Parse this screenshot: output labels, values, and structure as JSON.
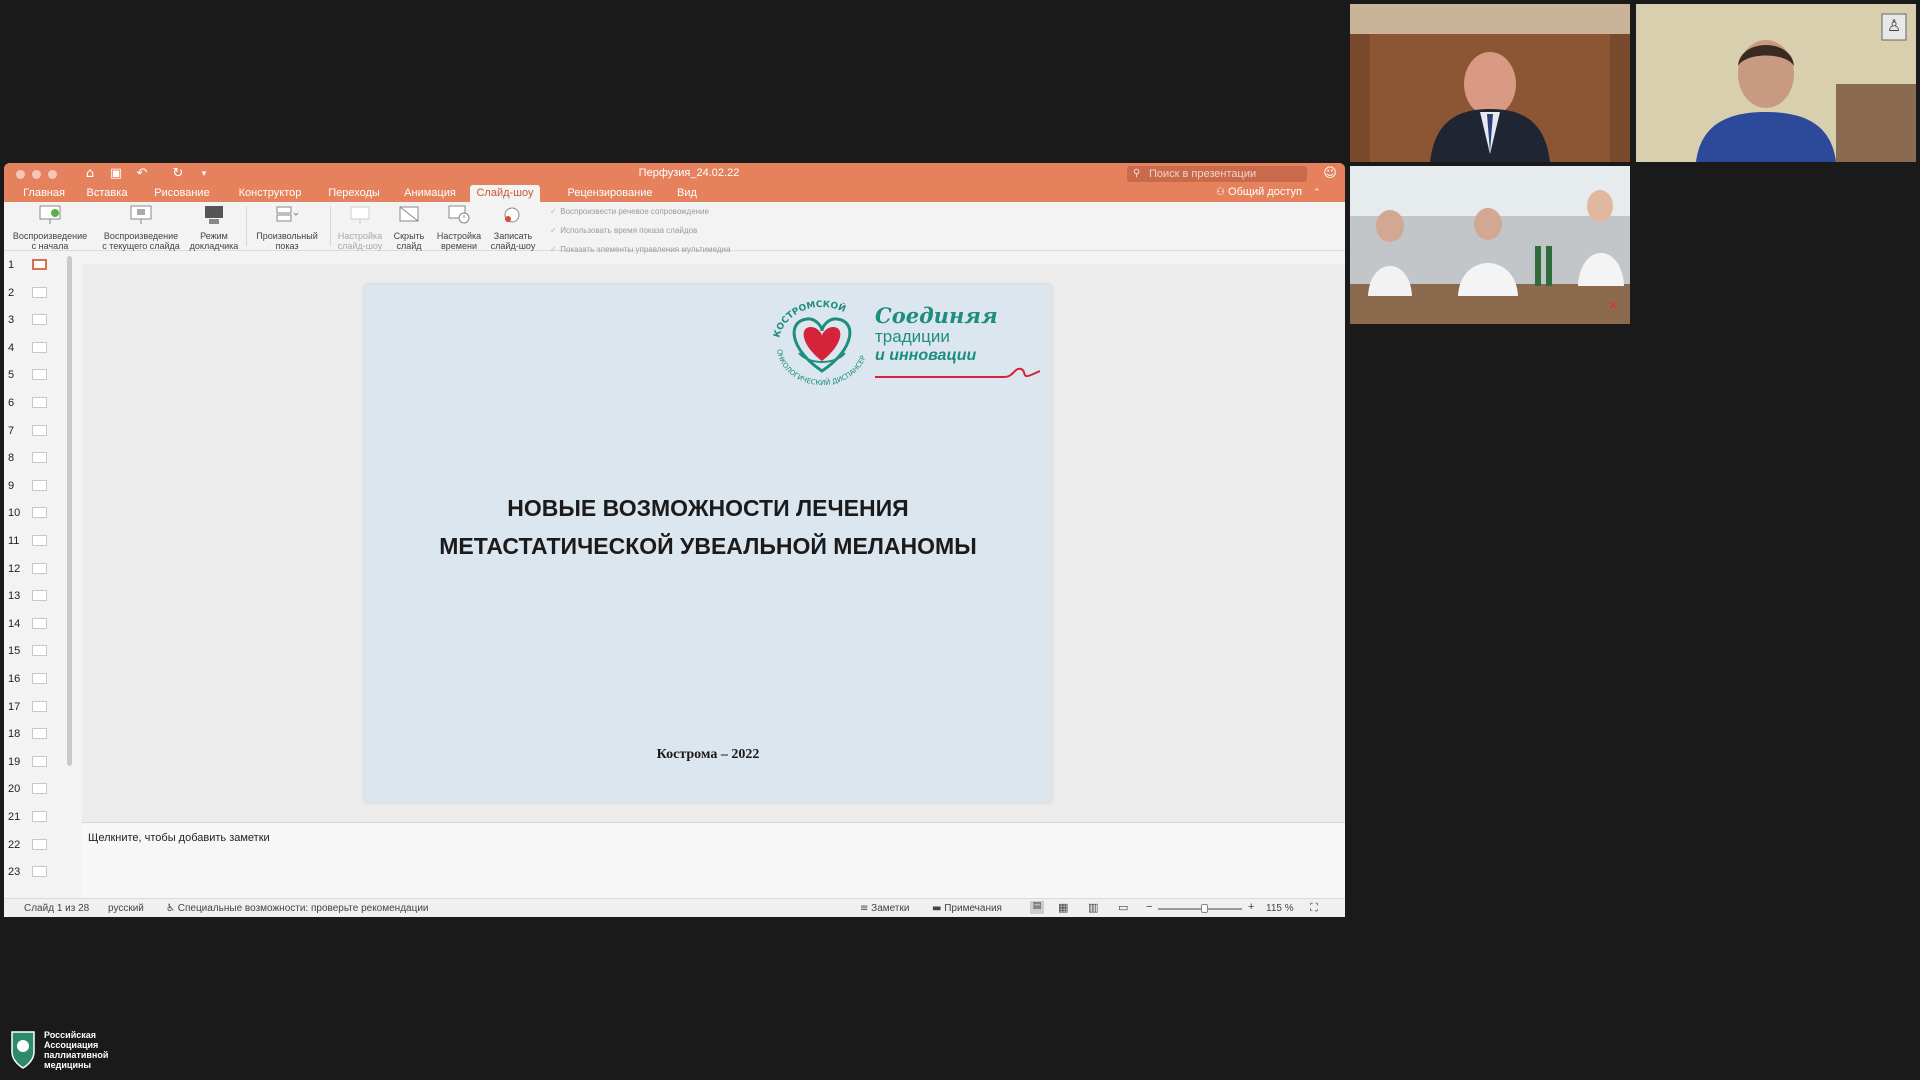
{
  "app": {
    "document_title": "Перфузия_24.02.22",
    "search_placeholder": "Поиск в презентации",
    "tabs": [
      "Главная",
      "Вставка",
      "Рисование",
      "Конструктор",
      "Переходы",
      "Анимация",
      "Слайд-шоу",
      "Рецензирование",
      "Вид"
    ],
    "active_tab": "Слайд-шоу",
    "share_label": "Общий доступ"
  },
  "ribbon": {
    "buttons": [
      {
        "label1": "Воспроизведение",
        "label2": "с начала"
      },
      {
        "label1": "Воспроизведение",
        "label2": "с текущего слайда"
      },
      {
        "label1": "Режим",
        "label2": "докладчика"
      },
      {
        "label1": "Произвольный",
        "label2": "показ"
      },
      {
        "label1": "Настройка",
        "label2": "слайд-шоу"
      },
      {
        "label1": "Скрыть",
        "label2": "слайд"
      },
      {
        "label1": "Настройка",
        "label2": "времени"
      },
      {
        "label1": "Записать",
        "label2": "слайд-шоу"
      }
    ],
    "checkboxes": [
      "Воспроизвести речевое сопровождение",
      "Использовать время показа слайдов",
      "Показать элементы управления мультимедиа"
    ]
  },
  "thumbnails": [
    "1",
    "2",
    "3",
    "4",
    "5",
    "6",
    "7",
    "8",
    "9",
    "10",
    "11",
    "12",
    "13",
    "14",
    "15",
    "16",
    "17",
    "18",
    "19",
    "20",
    "21",
    "22",
    "23"
  ],
  "slide": {
    "logo_arc_text": "КОСТРОМСКОЙ ОНКОЛОГИЧЕСКИЙ ДИСПАНСЕР",
    "logo_line1": "Соединяя",
    "logo_line2": "традиции",
    "logo_line3": "и инновации",
    "title_line1": "НОВЫЕ ВОЗМОЖНОСТИ ЛЕЧЕНИЯ",
    "title_line2": "МЕТАСТАТИЧЕСКОЙ УВЕАЛЬНОЙ МЕЛАНОМЫ",
    "footer": "Кострома – 2022"
  },
  "notes_placeholder": "Щелкните, чтобы добавить заметки",
  "status": {
    "slide_counter": "Слайд 1 из 28",
    "language": "русский",
    "accessibility": "Специальные возможности: проверьте рекомендации",
    "notes_label": "Заметки",
    "comments_label": "Примечания",
    "zoom": "115 %",
    "zoom_level_fraction": 0.55
  },
  "watermark": {
    "line1": "Российская",
    "line2": "Ассоциация",
    "line3": "паллиативной",
    "line4": "медицины"
  },
  "colors": {
    "accent": "#e6815e",
    "logo_green": "#1d8e7e",
    "logo_red": "#d4233a",
    "slide_bg": "#dce6ee"
  }
}
